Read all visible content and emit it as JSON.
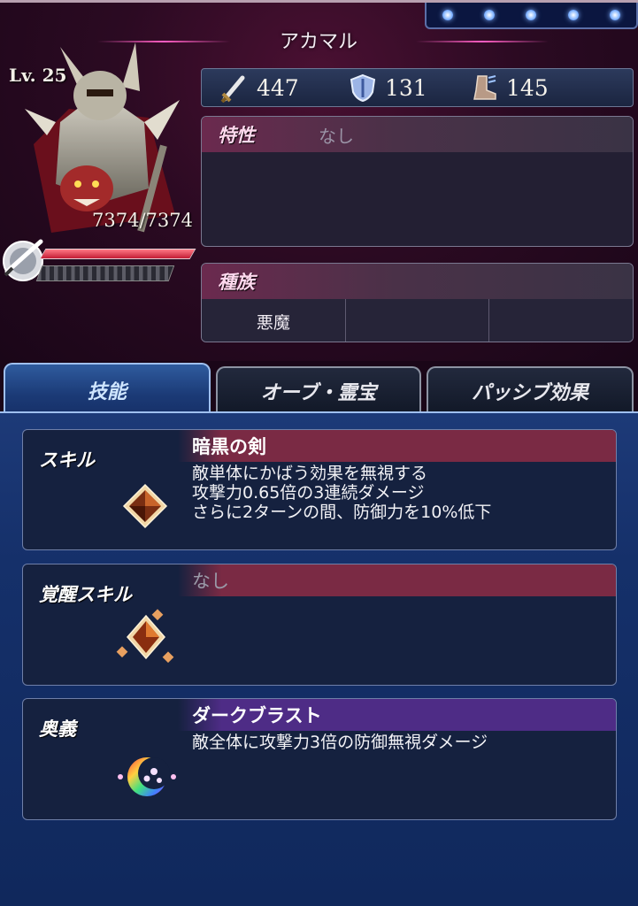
{
  "character": {
    "name": "アカマル",
    "level": "Lv. 25",
    "hp": "7374/7374"
  },
  "stats": {
    "attack": "447",
    "defense": "131",
    "speed": "145"
  },
  "trait": {
    "label": "特性",
    "value": "なし"
  },
  "race": {
    "label": "種族",
    "cells": [
      "悪魔",
      "",
      ""
    ]
  },
  "tabs": [
    {
      "label": "技能"
    },
    {
      "label": "オーブ・霊宝"
    },
    {
      "label": "パッシブ効果"
    }
  ],
  "skills": {
    "skill": {
      "label": "スキル",
      "name": "暗黒の剣",
      "desc": [
        "敵単体にかばう効果を無視する",
        "攻撃力0.65倍の3連続ダメージ",
        "さらに2ターンの間、防御力を10%低下"
      ]
    },
    "awaken": {
      "label": "覚醒スキル",
      "name": "なし"
    },
    "ougi": {
      "label": "奥義",
      "name": "ダークブラスト",
      "desc": [
        "敵全体に攻撃力3倍の防御無視ダメージ"
      ]
    }
  },
  "colors": {
    "skill_title": "#7a2a44",
    "ougi_title": "#4e2c86",
    "active_tab": "#1b3a76"
  }
}
